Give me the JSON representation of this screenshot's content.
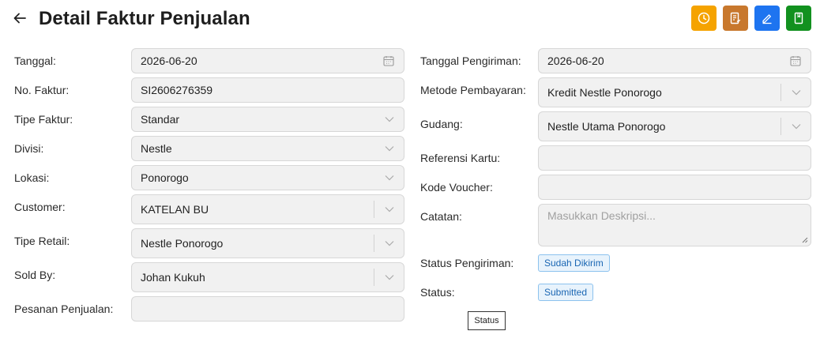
{
  "header": {
    "title": "Detail Faktur Penjualan",
    "colors": {
      "history": "#f5a300",
      "report": "#c8782d",
      "edit": "#1e74f0",
      "book": "#12911f"
    }
  },
  "left": {
    "tanggal_label": "Tanggal",
    "tanggal_value": "2026-06-20",
    "no_faktur_label": "No. Faktur",
    "no_faktur_value": "SI2606276359",
    "tipe_faktur_label": "Tipe Faktur",
    "tipe_faktur_value": "Standar",
    "divisi_label": "Divisi",
    "divisi_value": "Nestle",
    "lokasi_label": "Lokasi",
    "lokasi_value": "Ponorogo",
    "customer_label": "Customer",
    "customer_value": "KATELAN BU",
    "tipe_retail_label": "Tipe Retail",
    "tipe_retail_value": "Nestle Ponorogo",
    "sold_by_label": "Sold By",
    "sold_by_value": "Johan Kukuh",
    "pesanan_label": "Pesanan Penjualan",
    "pesanan_value": ""
  },
  "right": {
    "tanggal_pengiriman_label": "Tanggal Pengiriman",
    "tanggal_pengiriman_value": "2026-06-20",
    "metode_label": "Metode Pembayaran",
    "metode_value": "Kredit Nestle Ponorogo",
    "gudang_label": "Gudang",
    "gudang_value": "Nestle Utama Ponorogo",
    "referensi_label": "Referensi Kartu",
    "referensi_value": "",
    "voucher_label": "Kode Voucher",
    "voucher_value": "",
    "catatan_label": "Catatan",
    "catatan_placeholder": "Masukkan Deskripsi...",
    "status_pengiriman_label": "Status Pengiriman",
    "status_pengiriman_value": "Sudah Dikirim",
    "status_label": "Status",
    "status_value": "Submitted"
  },
  "tooltip": {
    "text": "Status"
  }
}
